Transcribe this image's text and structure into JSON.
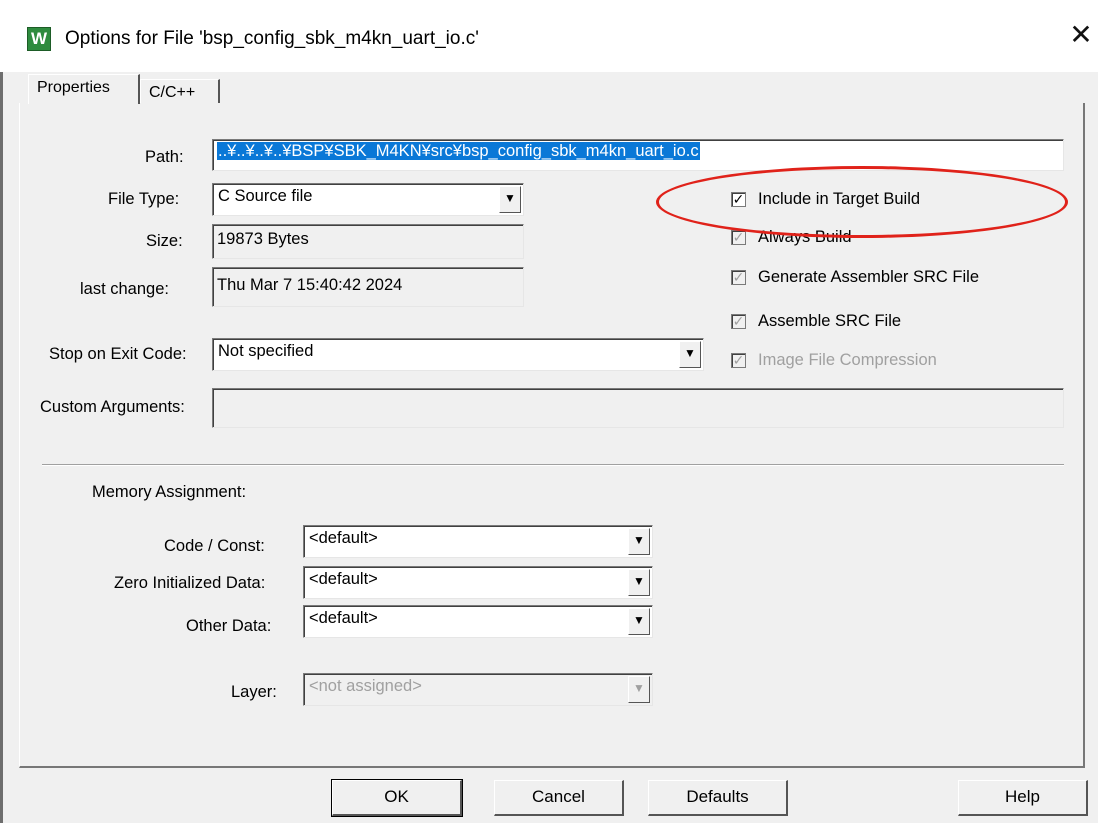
{
  "window": {
    "title": "Options for File 'bsp_config_sbk_m4kn_uart_io.c'",
    "app_icon": "keil-uvision-icon",
    "close_glyph": "✕"
  },
  "tabs": [
    {
      "label": "Properties",
      "active": true
    },
    {
      "label": "C/C++",
      "active": false
    }
  ],
  "file": {
    "path_label": "Path:",
    "path_value": "..¥..¥..¥..¥BSP¥SBK_M4KN¥src¥bsp_config_sbk_m4kn_uart_io.c",
    "file_type_label": "File Type:",
    "file_type_value": "C Source file",
    "size_label": "Size:",
    "size_value": "19873 Bytes",
    "last_change_label": "last change:",
    "last_change_value": "Thu Mar  7 15:40:42 2024",
    "stop_label": "Stop on Exit Code:",
    "stop_value": "Not specified",
    "custom_args_label": "Custom Arguments:",
    "custom_args_value": ""
  },
  "options": {
    "include_target_build": {
      "label": "Include in Target Build",
      "checked": true,
      "enabled": true
    },
    "always_build": {
      "label": "Always Build",
      "checked": true,
      "enabled": false
    },
    "generate_asm_src": {
      "label": "Generate Assembler SRC File",
      "checked": true,
      "enabled": false
    },
    "assemble_src": {
      "label": "Assemble SRC File",
      "checked": true,
      "enabled": false
    },
    "image_compression": {
      "label": "Image File Compression",
      "checked": true,
      "enabled": false
    }
  },
  "memory": {
    "heading": "Memory Assignment:",
    "code_const_label": "Code / Const:",
    "code_const_value": "<default>",
    "zero_init_label": "Zero Initialized Data:",
    "zero_init_value": "<default>",
    "other_data_label": "Other Data:",
    "other_data_value": "<default>",
    "layer_label": "Layer:",
    "layer_value": "<not assigned>"
  },
  "buttons": {
    "ok": "OK",
    "cancel": "Cancel",
    "defaults": "Defaults",
    "help": "Help"
  },
  "annotation": {
    "color": "#e0221a"
  },
  "glyphs": {
    "check": "✓",
    "dropdown": "▼"
  }
}
